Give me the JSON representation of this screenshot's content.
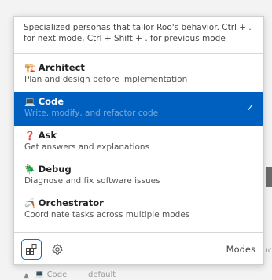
{
  "popup": {
    "description": "Specialized personas that tailor Roo's behavior. Ctrl + . for next mode, Ctrl + Shift + . for previous mode",
    "modes": [
      {
        "icon": "🏗️",
        "name": "Architect",
        "desc": "Plan and design before implementation",
        "selected": false
      },
      {
        "icon": "💻",
        "name": "Code",
        "desc": "Write, modify, and refactor code",
        "selected": true
      },
      {
        "icon": "❓",
        "name": "Ask",
        "desc": "Get answers and explanations",
        "selected": false
      },
      {
        "icon": "🪲",
        "name": "Debug",
        "desc": "Diagnose and fix software issues",
        "selected": false
      },
      {
        "icon": "🪃",
        "name": "Orchestrator",
        "desc": "Coordinate tasks across multiple modes",
        "selected": false
      }
    ],
    "check_glyph": "✓",
    "footer": {
      "label": "Modes"
    }
  },
  "background": {
    "chevron": "▲",
    "mode_label": "💻 Code",
    "profile_label": "default",
    "right_text": "ıc"
  },
  "colors": {
    "accent": "#0060c0",
    "icon_border": "#0a6fd0"
  }
}
